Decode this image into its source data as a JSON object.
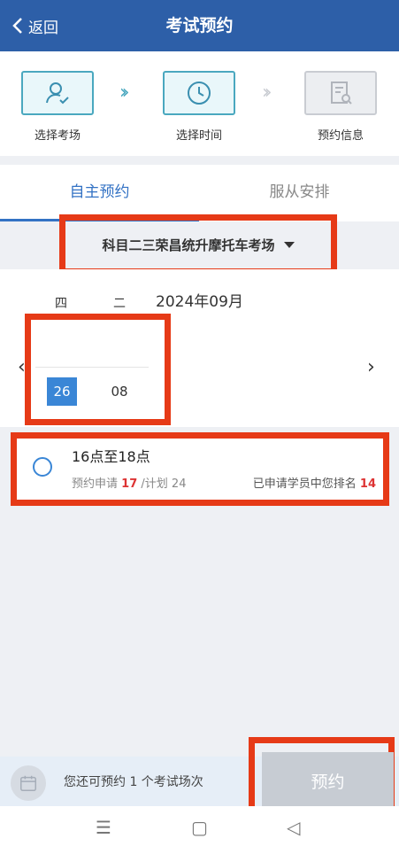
{
  "header": {
    "back_label": "返回",
    "title": "考试预约"
  },
  "steps": [
    {
      "label": "选择考场",
      "icon": "user-check-icon",
      "state": "done"
    },
    {
      "label": "选择时间",
      "icon": "clock-icon",
      "state": "current"
    },
    {
      "label": "预约信息",
      "icon": "document-search-icon",
      "state": "pending"
    }
  ],
  "tabs": [
    {
      "label": "自主预约",
      "active": true
    },
    {
      "label": "服从安排",
      "active": false
    }
  ],
  "venue": {
    "name": "科目二三荣昌统升摩托车考场"
  },
  "calendar": {
    "month": "2024年09月",
    "weekdays": [
      "四",
      "二"
    ],
    "days": [
      "26",
      "08"
    ],
    "selected_day": "26"
  },
  "slot": {
    "time": "16点至18点",
    "applied_label": "预约申请",
    "applied": "17",
    "plan_label": "/计划",
    "plan": "24",
    "rank_label": "已申请学员中您排名",
    "rank": "14"
  },
  "footer": {
    "remaining_text": "您还可预约 1 个考试场次",
    "book_label": "预约"
  },
  "colors": {
    "header_bg": "#2d5fa8",
    "accent": "#3372c4",
    "highlight_box": "#e63a17",
    "selected_day": "#3a86d6"
  }
}
